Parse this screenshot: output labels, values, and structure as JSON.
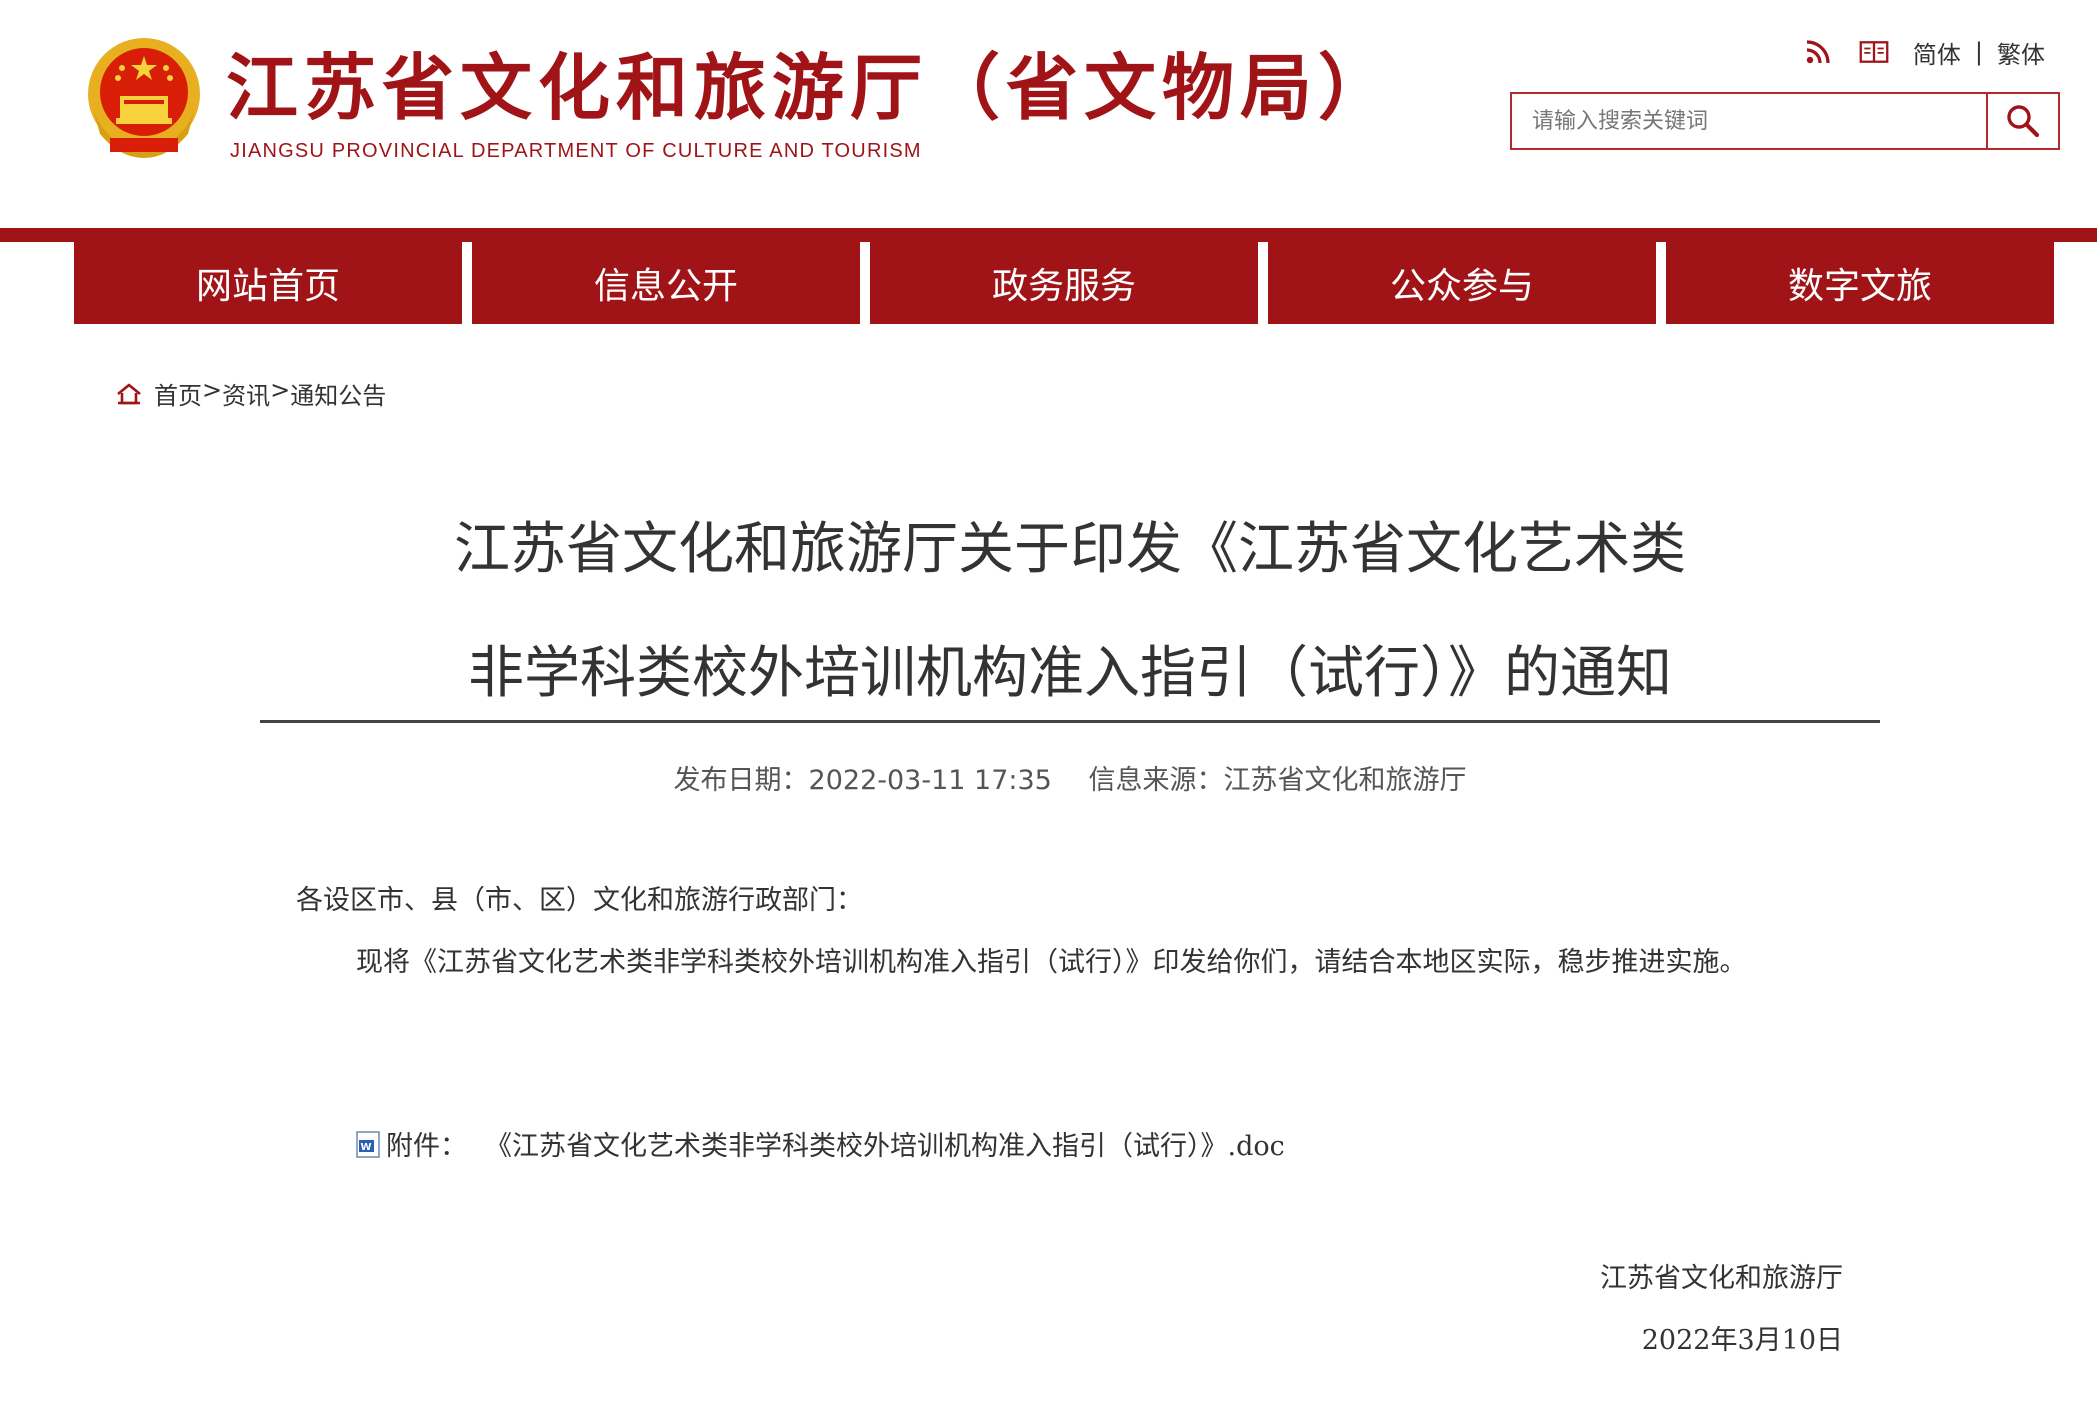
{
  "header": {
    "title": "江苏省文化和旅游厅（省文物局）",
    "subtitle": "JIANGSU PROVINCIAL DEPARTMENT OF CULTURE AND TOURISM",
    "util": {
      "simplified": "简体",
      "separator": "|",
      "traditional": "繁体"
    },
    "search": {
      "placeholder": "请输入搜索关键词"
    }
  },
  "nav": {
    "items": [
      {
        "label": "网站首页"
      },
      {
        "label": "信息公开"
      },
      {
        "label": "政务服务"
      },
      {
        "label": "公众参与"
      },
      {
        "label": "数字文旅"
      }
    ]
  },
  "breadcrumb": {
    "home": "首页",
    "sep1": ">",
    "news": "资讯",
    "sep2": ">",
    "current": "通知公告"
  },
  "article": {
    "title_line1": "江苏省文化和旅游厅关于印发《江苏省文化艺术类",
    "title_line2": "非学科类校外培训机构准入指引（试行）》的通知",
    "publish_date": "发布日期：2022-03-11  17:35",
    "source": "信息来源：江苏省文化和旅游厅",
    "salutation": "各设区市、县（市、区）文化和旅游行政部门：",
    "body": "现将《江苏省文化艺术类非学科类校外培训机构准入指引（试行）》印发给你们，请结合本地区实际，稳步推进实施。",
    "attachment_label": "附件：",
    "attachment_file": "《江苏省文化艺术类非学科类校外培训机构准入指引（试行）》.doc",
    "signer": "江苏省文化和旅游厅",
    "sign_date": "2022年3月10日"
  },
  "colors": {
    "brand_red": "#a01418",
    "text": "#333333"
  },
  "icons": {
    "emblem": "national-emblem-icon",
    "rss": "rss-icon",
    "reader": "book-icon",
    "search": "search-icon",
    "home": "home-icon",
    "doc": "word-doc-icon"
  }
}
